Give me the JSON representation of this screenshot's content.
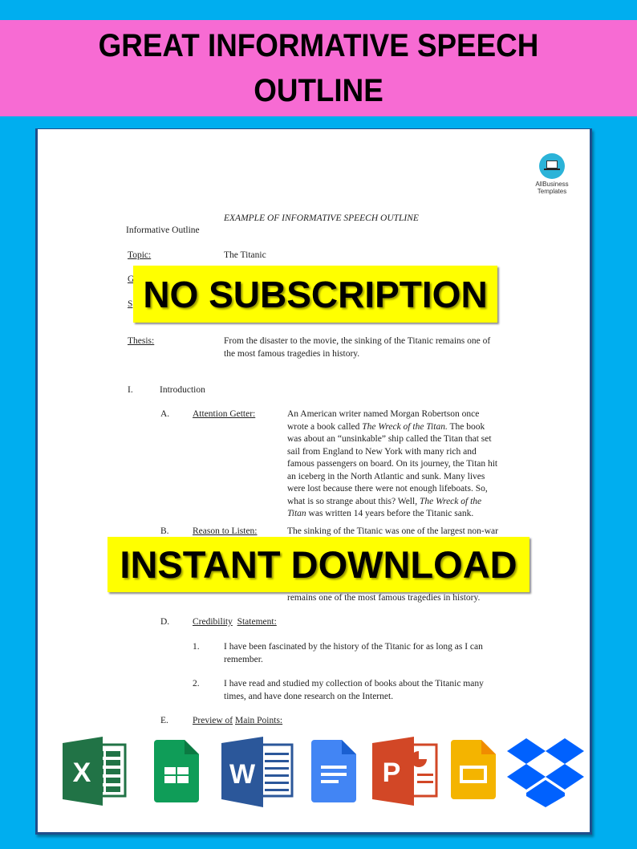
{
  "header": {
    "title": "GREAT INFORMATIVE SPEECH OUTLINE"
  },
  "logo": {
    "icon": "laptop-icon",
    "line1": "AllBusiness",
    "line2": "Templates"
  },
  "document": {
    "heading": "EXAMPLE OF INFORMATIVE SPEECH OUTLINE",
    "subheading": "Informative Outline",
    "topic_label": "Topic:",
    "topic_value": "The Titanic",
    "general_purpose_label_partial": "G",
    "specific_purpose_label_partial": "S",
    "thesis_label": "Thesis:",
    "thesis_lines": [
      "From the disaster to the movie, the sinking of the Titanic   remains one of",
      "the most famous tragedies in history."
    ],
    "section_I": {
      "numeral": "I.",
      "label": "Introduction",
      "A": {
        "letter": "A.",
        "label": "Attention Getter:",
        "lines": [
          "An American writer named Morgan Robertson once",
          "wrote a book called <i>The Wreck of the Titan.</i> The book",
          "was about an “unsinkable” ship called the Titan that set",
          "sail from England to New York with   many rich and",
          "famous passengers on board. On its journey, the Titan hit",
          "an iceberg in the North Atlantic and sunk. Many lives",
          "were lost because there were not enough lifeboats. So,",
          "what is so strange about this? Well, <i>The Wreck of the</i>",
          "<i>Titan</i> was written 14 years before the Titanic sank."
        ]
      },
      "B": {
        "letter": "B.",
        "label": "Reason to Listen:",
        "first_line": "The sinking of the Titanic was one of the largest non-war",
        "last_line": "remains one of the most famous tragedies in history."
      },
      "D": {
        "letter": "D.",
        "label_part1": "Credibility",
        "label_part2": "Statement:",
        "items": [
          {
            "num": "1.",
            "lines": [
              "I have been fascinated by the history of the Titanic for as long as I can",
              "remember."
            ]
          },
          {
            "num": "2.",
            "lines": [
              "I have read and studied my collection of books about the Titanic    many",
              "times, and have done research on the Internet."
            ]
          }
        ]
      },
      "E": {
        "letter": "E.",
        "label_part1": "Preview of",
        "label_part2": "Main Points:"
      }
    }
  },
  "banners": {
    "top": "NO SUBSCRIPTION",
    "bottom": "INSTANT DOWNLOAD"
  },
  "apps": [
    {
      "name": "excel-icon",
      "glyph": "X",
      "color": "#217346"
    },
    {
      "name": "google-sheets-icon",
      "glyph": "",
      "color": "#0F9D58"
    },
    {
      "name": "word-icon",
      "glyph": "W",
      "color": "#2B579A"
    },
    {
      "name": "google-docs-icon",
      "glyph": "",
      "color": "#4285F4"
    },
    {
      "name": "powerpoint-icon",
      "glyph": "P",
      "color": "#D24726"
    },
    {
      "name": "google-slides-icon",
      "glyph": "",
      "color": "#F4B400"
    },
    {
      "name": "dropbox-icon",
      "glyph": "",
      "color": "#0061FE"
    }
  ],
  "colors": {
    "background": "#00AEEF",
    "title_band": "#F76BD3",
    "banner": "#FFFF00",
    "page_border": "#1F4E8C"
  }
}
